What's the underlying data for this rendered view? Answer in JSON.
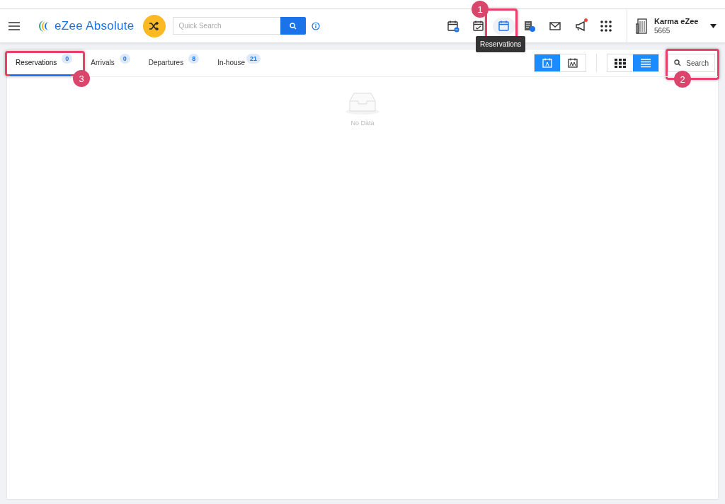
{
  "header": {
    "app_name": "eZee Absolute",
    "search": {
      "placeholder": "Quick Search"
    },
    "toolbar": [
      {
        "kind": "calendar-plus",
        "selected": false,
        "notify": false
      },
      {
        "kind": "calendar-check",
        "selected": false,
        "notify": false
      },
      {
        "kind": "calendar",
        "selected": true,
        "notify": false
      },
      {
        "kind": "bill",
        "selected": false,
        "notify": false
      },
      {
        "kind": "mail",
        "selected": false,
        "notify": false
      },
      {
        "kind": "megaphone",
        "selected": false,
        "notify": true
      },
      {
        "kind": "apps",
        "selected": false,
        "notify": false
      }
    ],
    "tooltip": "Reservations",
    "property": {
      "name": "Karma eZee",
      "code": "5665"
    }
  },
  "tabs": [
    {
      "label": "Reservations",
      "count": "0",
      "selected": true
    },
    {
      "label": "Arrivals",
      "count": "0",
      "selected": false
    },
    {
      "label": "Departures",
      "count": "8",
      "selected": false
    },
    {
      "label": "In-house",
      "count": "21",
      "selected": false
    }
  ],
  "view_toggles": [
    {
      "kind": "guest",
      "selected": true
    },
    {
      "kind": "group",
      "selected": false
    }
  ],
  "layout_toggles": [
    {
      "kind": "grid",
      "selected": false
    },
    {
      "kind": "list",
      "selected": true
    }
  ],
  "search_button": "Search",
  "empty_text": "No Data",
  "callouts": [
    "1",
    "2",
    "3"
  ]
}
